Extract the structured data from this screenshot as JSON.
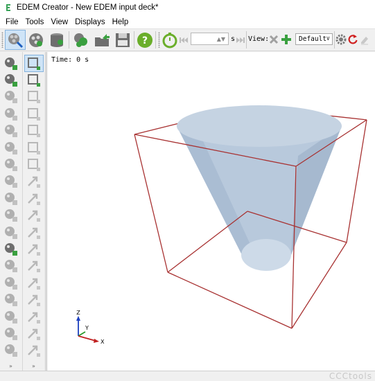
{
  "window": {
    "title": "EDEM Creator - New EDEM input deck*"
  },
  "menu": {
    "items": [
      "File",
      "Tools",
      "View",
      "Displays",
      "Help"
    ]
  },
  "toolbar": {
    "time_unit": "s",
    "view_label": "View:",
    "view_preset": "Default",
    "icons": [
      "geometry-view-icon",
      "particle-view-icon",
      "database-icon",
      "particles-group-icon",
      "export-folder-icon",
      "save-icon",
      "help-icon",
      "stopwatch-icon",
      "skip-back-icon",
      "skip-forward-icon",
      "delete-view-icon",
      "add-view-icon",
      "settings-gear-icon",
      "reset-view-icon",
      "eraser-icon"
    ]
  },
  "viewport": {
    "time_label": "Time:",
    "time_value": "0 s",
    "axes": {
      "z": "Z",
      "y": "Y",
      "x": "X"
    },
    "colors": {
      "domain_box": "#a83232",
      "cone": "#c5d3e2",
      "axis_z": "#1c3fbf",
      "axis_y": "#2a9a2a",
      "axis_x": "#c02020"
    }
  },
  "statusbar": {
    "watermark": "CCCtools"
  }
}
